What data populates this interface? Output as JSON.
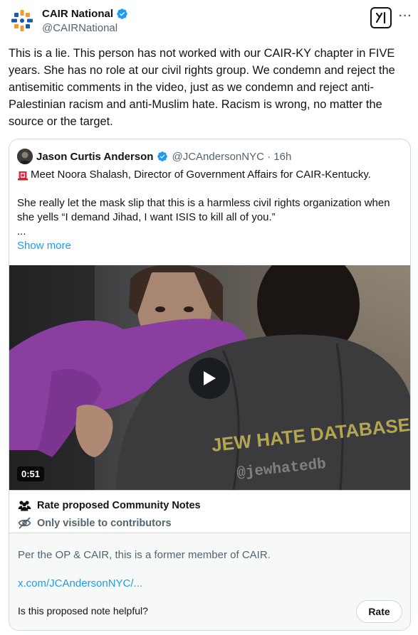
{
  "author": {
    "name": "CAIR National",
    "handle": "@CAIRNational"
  },
  "tweet": {
    "text": "This is a lie. This person has not worked with our CAIR-KY chapter in FIVE years. She has no role at our civil rights group. We condemn and reject the antisemitic comments in the video, just as we condemn and reject anti-Palestinian racism and anti-Muslim hate. Racism is wrong, no matter the source or the target."
  },
  "quoted": {
    "name": "Jason Curtis Anderson",
    "handle_time": "@JCAndersonNYC · 16h",
    "line1": "Meet Noora Shalash, Director of Government Affairs for CAIR-Kentucky.",
    "para": "She really let the mask slip that this is a harmless civil rights organization when she yells “I demand Jihad, I want ISIS to kill all of you.”",
    "ellipsis": "...",
    "show_more": "Show more",
    "video": {
      "duration": "0:51",
      "watermark_line1": "JEW HATE DATABASE",
      "watermark_line2": "@jewhatedb"
    }
  },
  "community_notes": {
    "rate_label": "Rate proposed Community Notes",
    "visibility_label": "Only visible to contributors",
    "note_text": "Per the OP & CAIR, this is a former member of CAIR.",
    "note_link": "x.com/JCAndersonNYC/...",
    "helpful_question": "Is this proposed note helpful?",
    "rate_button": "Rate"
  },
  "icons": {
    "verified": "verified-badge-icon",
    "grok": "grok-icon",
    "more": "more-icon",
    "siren": "siren-emoji-icon",
    "play": "play-icon",
    "people": "people-icon",
    "eye_off": "eye-off-icon"
  },
  "colors": {
    "accent": "#1d9bf0",
    "text": "#0f1419",
    "muted": "#536471",
    "border": "#cfd9de"
  }
}
